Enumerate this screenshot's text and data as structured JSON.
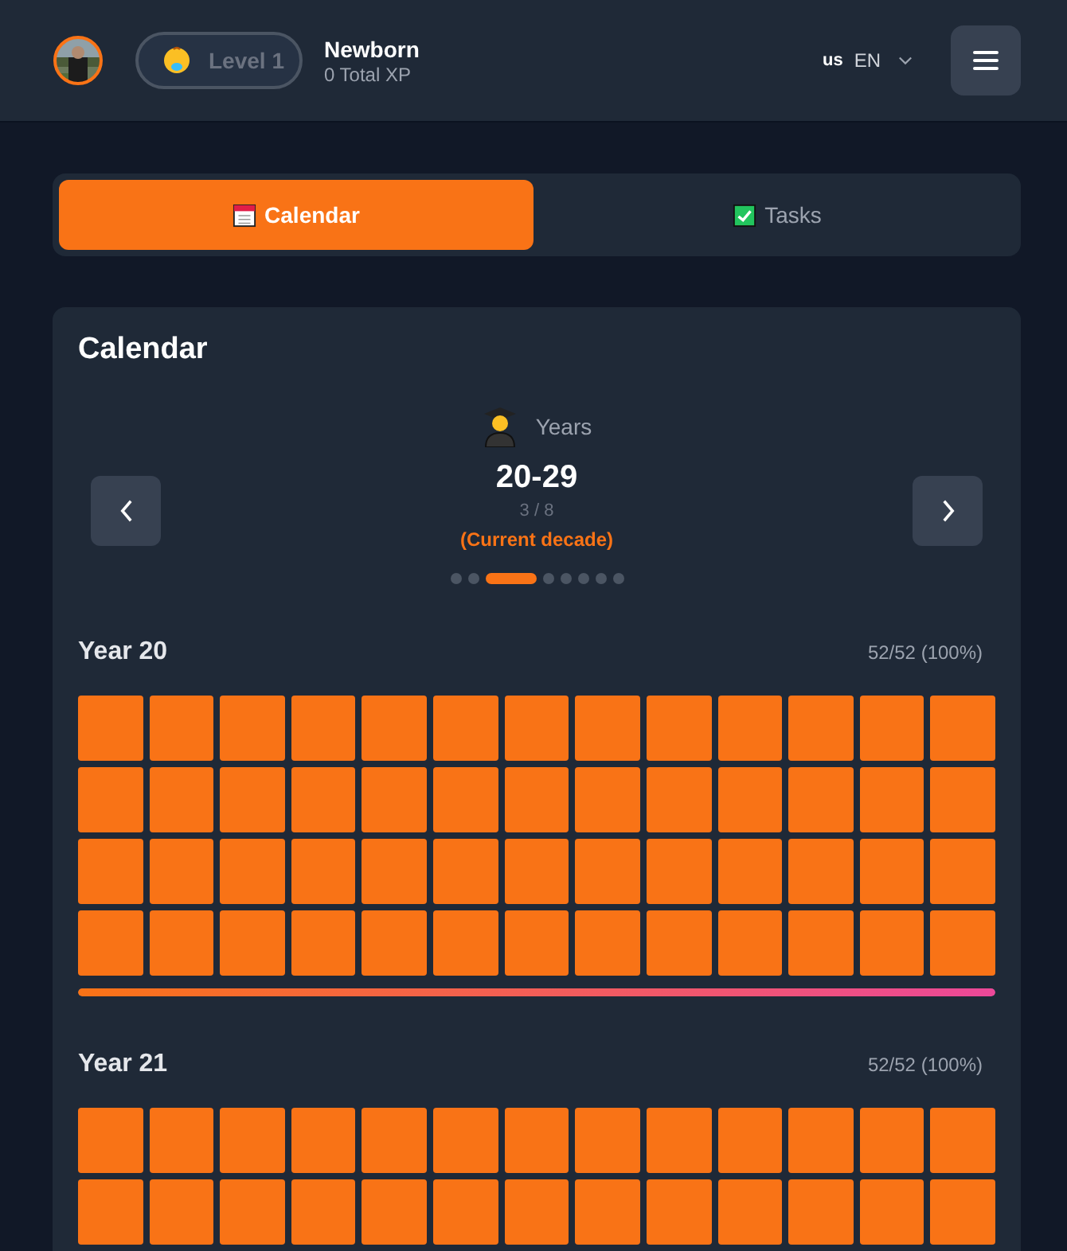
{
  "header": {
    "level_badge": "Level 1",
    "rank": "Newborn",
    "xp": "0 Total XP",
    "language": {
      "flag": "us",
      "code": "EN"
    }
  },
  "tabs": [
    {
      "label": "Calendar",
      "kind": "calendar",
      "selected": true
    },
    {
      "label": "Tasks",
      "kind": "tasks",
      "selected": false
    }
  ],
  "calendar": {
    "title": "Calendar",
    "period_label": "Years",
    "range": "20-29",
    "position": "3 / 8",
    "note": "(Current decade)",
    "pages": [
      {
        "selected": false
      },
      {
        "selected": false
      },
      {
        "selected": true
      },
      {
        "selected": false
      },
      {
        "selected": false
      },
      {
        "selected": false
      },
      {
        "selected": false
      },
      {
        "selected": false
      }
    ],
    "years": [
      {
        "title": "Year 20",
        "count": "52/52 (100%)",
        "level": 1,
        "weeks": [
          {
            "filled": true
          },
          {
            "filled": true
          },
          {
            "filled": true
          },
          {
            "filled": true
          },
          {
            "filled": true
          },
          {
            "filled": true
          },
          {
            "filled": true
          },
          {
            "filled": true
          },
          {
            "filled": true
          },
          {
            "filled": true
          },
          {
            "filled": true
          },
          {
            "filled": true
          },
          {
            "filled": true
          },
          {
            "filled": true
          },
          {
            "filled": true
          },
          {
            "filled": true
          },
          {
            "filled": true
          },
          {
            "filled": true
          },
          {
            "filled": true
          },
          {
            "filled": true
          },
          {
            "filled": true
          },
          {
            "filled": true
          },
          {
            "filled": true
          },
          {
            "filled": true
          },
          {
            "filled": true
          },
          {
            "filled": true
          },
          {
            "filled": true
          },
          {
            "filled": true
          },
          {
            "filled": true
          },
          {
            "filled": true
          },
          {
            "filled": true
          },
          {
            "filled": true
          },
          {
            "filled": true
          },
          {
            "filled": true
          },
          {
            "filled": true
          },
          {
            "filled": true
          },
          {
            "filled": true
          },
          {
            "filled": true
          },
          {
            "filled": true
          },
          {
            "filled": true
          },
          {
            "filled": true
          },
          {
            "filled": true
          },
          {
            "filled": true
          },
          {
            "filled": true
          },
          {
            "filled": true
          },
          {
            "filled": true
          },
          {
            "filled": true
          },
          {
            "filled": true
          },
          {
            "filled": true
          },
          {
            "filled": true
          },
          {
            "filled": true
          },
          {
            "filled": true
          }
        ]
      },
      {
        "title": "Year 21",
        "count": "52/52 (100%)",
        "weeks": [
          {
            "filled": true
          },
          {
            "filled": true
          },
          {
            "filled": true
          },
          {
            "filled": true
          },
          {
            "filled": true
          },
          {
            "filled": true
          },
          {
            "filled": true
          },
          {
            "filled": true
          },
          {
            "filled": true
          },
          {
            "filled": true
          },
          {
            "filled": true
          },
          {
            "filled": true
          },
          {
            "filled": true
          },
          {
            "filled": true
          },
          {
            "filled": true
          },
          {
            "filled": true
          },
          {
            "filled": true
          },
          {
            "filled": true
          },
          {
            "filled": true
          },
          {
            "filled": true
          },
          {
            "filled": true
          },
          {
            "filled": true
          },
          {
            "filled": true
          },
          {
            "filled": true
          },
          {
            "filled": true
          },
          {
            "filled": true
          }
        ]
      }
    ]
  }
}
